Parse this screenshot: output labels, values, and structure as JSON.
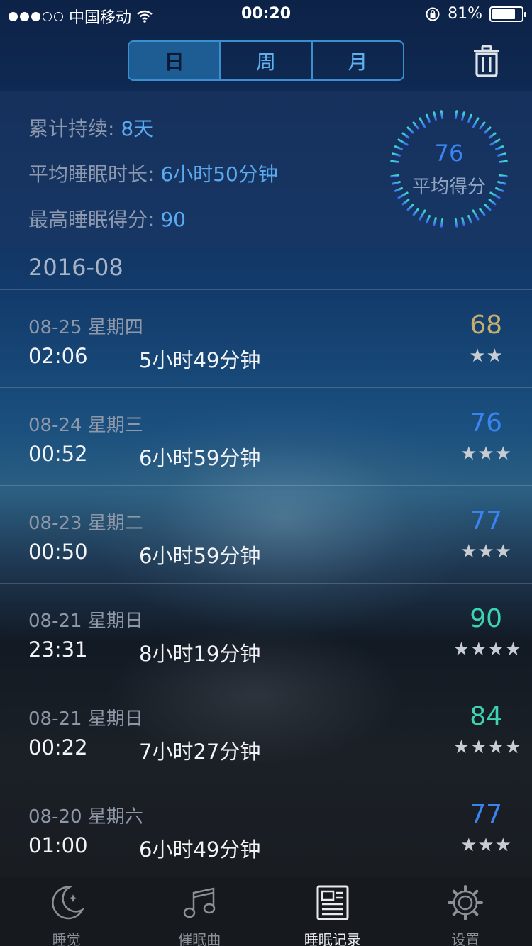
{
  "status_bar": {
    "carrier": "中国移动",
    "time": "00:20",
    "battery": "81%",
    "battery_level": 0.81
  },
  "tabs_top": [
    "日",
    "周",
    "月"
  ],
  "summary": {
    "days_label": "累计持续: ",
    "days_value": "8天",
    "avg_duration_label": "平均睡眠时长: ",
    "avg_duration_value": "6小时50分钟",
    "best_score_label": "最高睡眠得分: ",
    "best_score_value": "90",
    "gauge_score": "76",
    "gauge_label": "平均得分"
  },
  "month": "2016-08",
  "records": [
    {
      "date": "08-25 星期四",
      "time": "02:06",
      "duration": "5小时49分钟",
      "score": "68",
      "stars": "★★",
      "color": "#c7ad6e"
    },
    {
      "date": "08-24 星期三",
      "time": "00:52",
      "duration": "6小时59分钟",
      "score": "76",
      "stars": "★★★",
      "color": "#3a84f2"
    },
    {
      "date": "08-23 星期二",
      "time": "00:50",
      "duration": "6小时59分钟",
      "score": "77",
      "stars": "★★★",
      "color": "#3a84f2"
    },
    {
      "date": "08-21 星期日",
      "time": "23:31",
      "duration": "8小时19分钟",
      "score": "90",
      "stars": "★★★★",
      "color": "#3cd2b2"
    },
    {
      "date": "08-21 星期日",
      "time": "00:22",
      "duration": "7小时27分钟",
      "score": "84",
      "stars": "★★★★",
      "color": "#3cd2b2"
    },
    {
      "date": "08-20 星期六",
      "time": "01:00",
      "duration": "6小时49分钟",
      "score": "77",
      "stars": "★★★",
      "color": "#3a84f2"
    }
  ],
  "tabbar": [
    {
      "label": "睡觉",
      "icon": "moon-icon"
    },
    {
      "label": "催眠曲",
      "icon": "music-icon"
    },
    {
      "label": "睡眠记录",
      "icon": "record-icon"
    },
    {
      "label": "设置",
      "icon": "gear-icon"
    }
  ],
  "colors": {
    "accent": "#3a8fd0",
    "score_blue": "#3a84f2",
    "score_green": "#3cd2b2",
    "score_gold": "#c7ad6e"
  }
}
